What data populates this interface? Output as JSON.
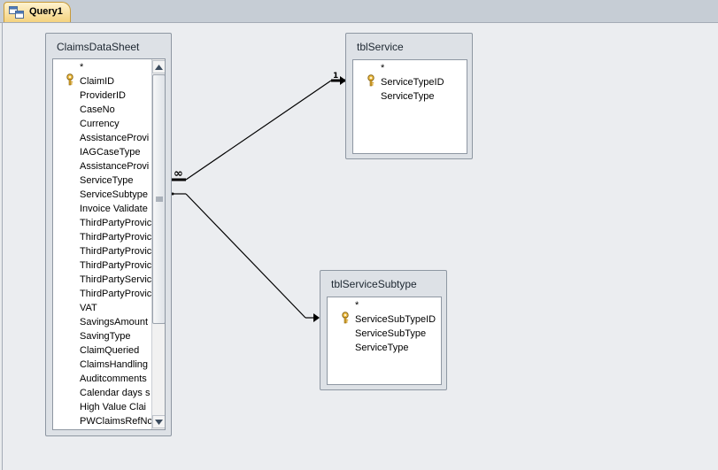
{
  "tab": {
    "label": "Query1",
    "icon": "query-icon"
  },
  "tables": {
    "claims": {
      "title": "ClaimsDataSheet",
      "fields": [
        {
          "name": "*",
          "key": false
        },
        {
          "name": "ClaimID",
          "key": true
        },
        {
          "name": "ProviderID",
          "key": false
        },
        {
          "name": "CaseNo",
          "key": false
        },
        {
          "name": "Currency",
          "key": false
        },
        {
          "name": "AssistanceProvi",
          "key": false
        },
        {
          "name": "IAGCaseType",
          "key": false
        },
        {
          "name": "AssistanceProvi",
          "key": false
        },
        {
          "name": "ServiceType",
          "key": false
        },
        {
          "name": "ServiceSubtype",
          "key": false
        },
        {
          "name": "Invoice Validate",
          "key": false
        },
        {
          "name": "ThirdPartyProvic",
          "key": false
        },
        {
          "name": "ThirdPartyProvic",
          "key": false
        },
        {
          "name": "ThirdPartyProvic",
          "key": false
        },
        {
          "name": "ThirdPartyProvic",
          "key": false
        },
        {
          "name": "ThirdPartyServic",
          "key": false
        },
        {
          "name": "ThirdPartyProvic",
          "key": false
        },
        {
          "name": "VAT",
          "key": false
        },
        {
          "name": "SavingsAmount",
          "key": false
        },
        {
          "name": "SavingType",
          "key": false
        },
        {
          "name": "ClaimQueried",
          "key": false
        },
        {
          "name": "ClaimsHandling",
          "key": false
        },
        {
          "name": "Auditcomments",
          "key": false
        },
        {
          "name": "Calendar days s",
          "key": false
        },
        {
          "name": "High Value Clai",
          "key": false
        },
        {
          "name": "PWClaimsRefNc",
          "key": false
        }
      ]
    },
    "service": {
      "title": "tblService",
      "fields": [
        {
          "name": "*",
          "key": false
        },
        {
          "name": "ServiceTypeID",
          "key": true
        },
        {
          "name": "ServiceType",
          "key": false
        }
      ]
    },
    "subtype": {
      "title": "tblServiceSubtype",
      "fields": [
        {
          "name": "*",
          "key": false
        },
        {
          "name": "ServiceSubTypeID",
          "key": true
        },
        {
          "name": "ServiceSubType",
          "key": false
        },
        {
          "name": "ServiceType",
          "key": false
        }
      ]
    }
  },
  "joins": [
    {
      "from": "ClaimsDataSheet.ServiceType",
      "to": "tblService.ServiceTypeID",
      "from_label": "∞",
      "to_label": "1"
    },
    {
      "from": "ClaimsDataSheet.ServiceSubtype",
      "to": "tblServiceSubtype.ServiceSubTypeID"
    }
  ]
}
